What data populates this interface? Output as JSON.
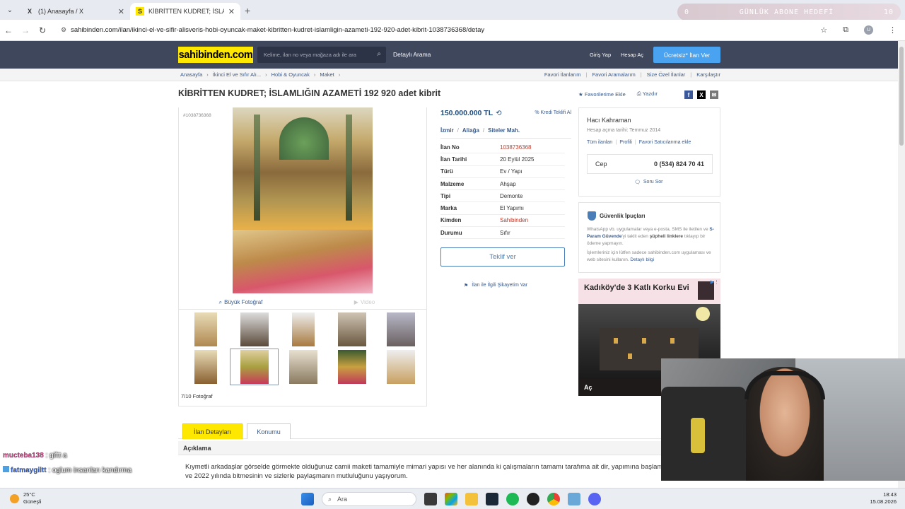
{
  "browser": {
    "tabs": [
      {
        "title": "(1) Anasayfa / X",
        "favicon": "X",
        "active": false
      },
      {
        "title": "KİBRİTTEN KUDRET; İSLAMLIĞ",
        "favicon": "S",
        "active": true
      }
    ],
    "url": "sahibinden.com/ilan/ikinci-el-ve-sifir-alisveris-hobi-oyuncak-maket-kibritten-kudret-islamligin-azameti-192-920-adet-kibrit-1038736368/detay",
    "profile_initial": "U"
  },
  "stream_overlay": {
    "left_value": "0",
    "label": "GÜNLÜK ABONE HEDEFİ",
    "right_value": "10"
  },
  "site": {
    "logo": "sahibinden.com",
    "search_placeholder": "Kelime, ilan no veya mağaza adı ile ara",
    "detailed_search": "Detaylı Arama",
    "login": "Giriş Yap",
    "register": "Hesap Aç",
    "post_ad": "Ücretsiz* İlan Ver",
    "breadcrumbs": [
      "Anasayfa",
      "İkinci El ve Sıfır Alı...",
      "Hobi & Oyuncak",
      "Maket"
    ],
    "top_links": [
      "Favori İlanlarım",
      "Favori Aramalarım",
      "Size Özel İlanlar",
      "Karşılaştır"
    ]
  },
  "listing": {
    "title": "KİBRİTTEN KUDRET; İSLAMLIĞIN AZAMETİ 192 920 adet kibrit",
    "add_favorite": "Favorilerime Ekle",
    "print": "Yazdır",
    "id_label": "#1038736368",
    "big_photo": "Büyük Fotoğraf",
    "video": "Video",
    "photo_count": "7/10 Fotoğraf",
    "price": "150.000.000 TL",
    "credit_offer": "Kredi Teklifi Al",
    "location": [
      "İzmir",
      "Aliağa",
      "Siteler Mah."
    ],
    "attributes": [
      {
        "key": "İlan No",
        "value": "1038736368",
        "red": true
      },
      {
        "key": "İlan Tarihi",
        "value": "20 Eylül 2025",
        "red": false
      },
      {
        "key": "Türü",
        "value": "Ev / Yapı",
        "red": false
      },
      {
        "key": "Malzeme",
        "value": "Ahşap",
        "red": false
      },
      {
        "key": "Tipi",
        "value": "Demonte",
        "red": false
      },
      {
        "key": "Marka",
        "value": "El Yapımı",
        "red": false
      },
      {
        "key": "Kimden",
        "value": "Sahibinden",
        "red": true
      },
      {
        "key": "Durumu",
        "value": "Sıfır",
        "red": false
      }
    ],
    "offer_button": "Teklif ver",
    "report": "İlan ile İlgili Şikayetim Var"
  },
  "seller": {
    "name": "Hacı Kahraman",
    "since": "Hesap açma tarihi: Temmuz 2014",
    "links": [
      "Tüm ilanları",
      "Profili",
      "Favori Satıcılarıma ekle"
    ],
    "phone_label": "Cep",
    "phone": "0 (534) 824 70 41",
    "ask": "Soru Sor"
  },
  "safety": {
    "title": "Güvenlik İpuçları",
    "p1_a": "WhatsApp vb. uygulamalar veya e-posta, SMS ile iletilen ve ",
    "p1_b": "S-Param Güvende",
    "p1_c": "'yi taklit eden ",
    "p1_d": "şüpheli linklere",
    "p1_e": " tıklayıp bir ödeme yapmayın.",
    "p2_a": "İşlemleriniz için lütfen sadece sahibinden.com uygulaması ve web sitesini kullanın. ",
    "p2_b": "Detaylı bilgi"
  },
  "ad": {
    "title": "Kadıköy'de 3 Katlı Korku Evi",
    "cta": "Aç"
  },
  "details": {
    "tab_details": "İlan Detayları",
    "tab_location": "Konumu",
    "section": "Açıklama",
    "text": "Kıymetli arkadaşlar görselde görmekte olduğunuz camii maketi tamamiyle mimari yapısı ve her alanında ki çalışmaların tamamı tarafıma ait dir, yapımına başlamış ve 2022 yılında bitmesinin ve sizlerle paylaşmanın mutluluğunu yaşıyorum."
  },
  "chat": [
    {
      "user": "mucteba138",
      "message": ": giftt a"
    },
    {
      "user": "fatmaygiltt",
      "message": ": oglum insanları kandırma"
    }
  ],
  "taskbar": {
    "temp": "25°C",
    "weather": "Güneşli",
    "search": "Ara",
    "time": "18:43",
    "date": "15.08.2026"
  }
}
